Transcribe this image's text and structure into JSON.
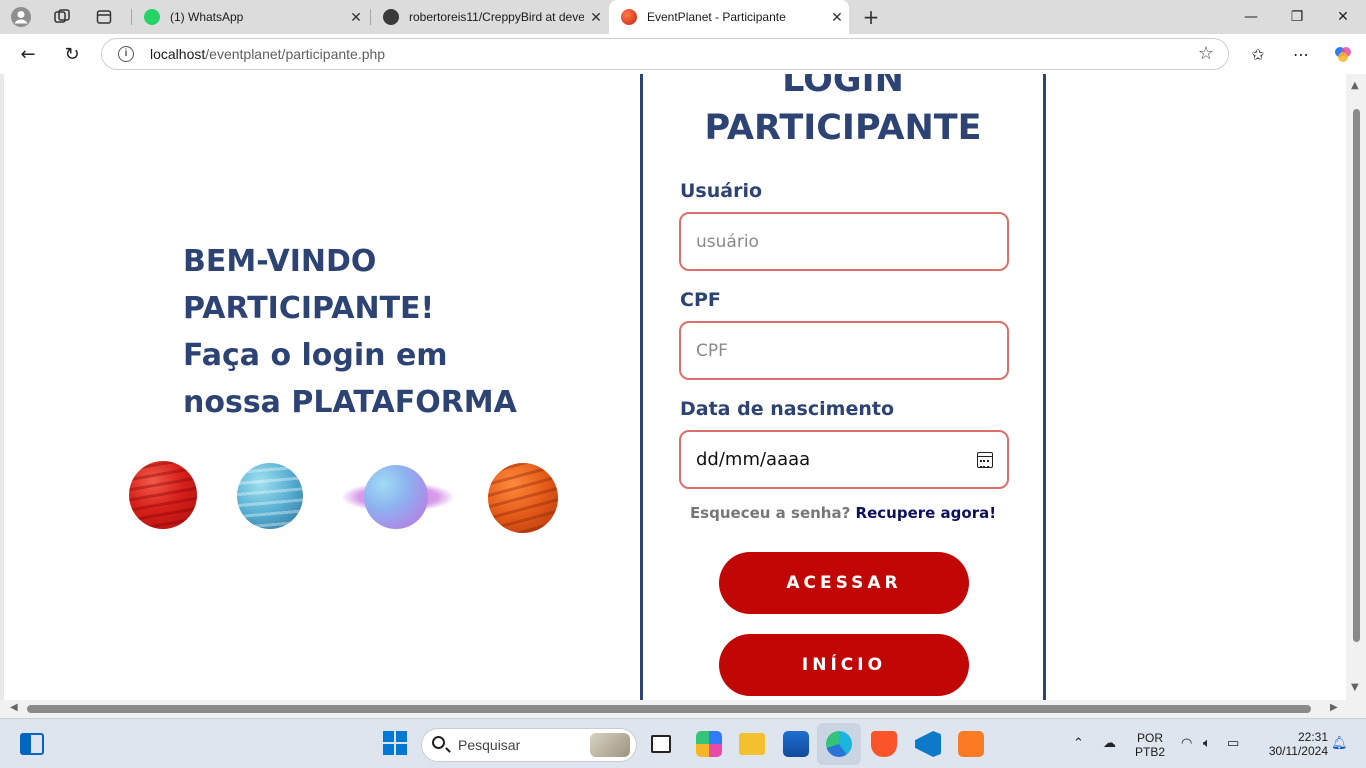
{
  "browser": {
    "tabs": [
      {
        "title": "(1) WhatsApp",
        "icon": "whatsapp-icon",
        "active": false
      },
      {
        "title": "robertoreis11/CreppyBird at deve",
        "icon": "github-icon",
        "active": false
      },
      {
        "title": "EventPlanet - Participante",
        "icon": "planet-favicon-icon",
        "active": true
      }
    ],
    "address": {
      "host": "localhost",
      "path": "/eventplanet/participante.php"
    }
  },
  "page": {
    "welcome_lines": [
      "BEM-VINDO",
      "PARTICIPANTE!",
      "Faça o login em",
      "nossa PLATAFORMA"
    ],
    "login": {
      "title_line1": "LOGIN",
      "title_line2": "PARTICIPANTE",
      "user_label": "Usuário",
      "user_placeholder": "usuário",
      "cpf_label": "CPF",
      "cpf_placeholder": "CPF",
      "birth_label": "Data de nascimento",
      "birth_value": "dd/mm/aaaa",
      "forgot_text": "Esqueceu a senha?",
      "forgot_link": "Recupere agora!",
      "access_button": "ACESSAR",
      "home_button": "INÍCIO"
    },
    "colors": {
      "primary_text": "#2d4373",
      "button": "#c10606",
      "input_border": "#d9706b",
      "link": "#0f0f5c"
    }
  },
  "taskbar": {
    "search_placeholder": "Pesquisar",
    "language": "POR",
    "keyboard": "PTB2",
    "time": "22:31",
    "date": "30/11/2024"
  }
}
